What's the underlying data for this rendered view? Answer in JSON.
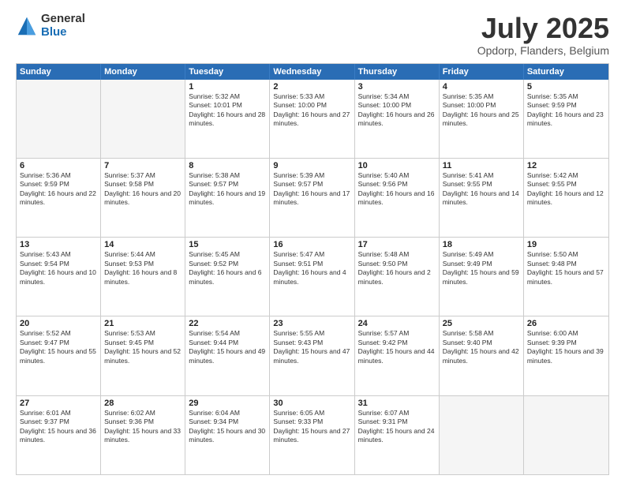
{
  "logo": {
    "general": "General",
    "blue": "Blue"
  },
  "title": "July 2025",
  "location": "Opdorp, Flanders, Belgium",
  "days": [
    "Sunday",
    "Monday",
    "Tuesday",
    "Wednesday",
    "Thursday",
    "Friday",
    "Saturday"
  ],
  "weeks": [
    [
      {
        "day": "",
        "empty": true
      },
      {
        "day": "",
        "empty": true
      },
      {
        "day": "1",
        "sunrise": "Sunrise: 5:32 AM",
        "sunset": "Sunset: 10:01 PM",
        "daylight": "Daylight: 16 hours and 28 minutes."
      },
      {
        "day": "2",
        "sunrise": "Sunrise: 5:33 AM",
        "sunset": "Sunset: 10:00 PM",
        "daylight": "Daylight: 16 hours and 27 minutes."
      },
      {
        "day": "3",
        "sunrise": "Sunrise: 5:34 AM",
        "sunset": "Sunset: 10:00 PM",
        "daylight": "Daylight: 16 hours and 26 minutes."
      },
      {
        "day": "4",
        "sunrise": "Sunrise: 5:35 AM",
        "sunset": "Sunset: 10:00 PM",
        "daylight": "Daylight: 16 hours and 25 minutes."
      },
      {
        "day": "5",
        "sunrise": "Sunrise: 5:35 AM",
        "sunset": "Sunset: 9:59 PM",
        "daylight": "Daylight: 16 hours and 23 minutes."
      }
    ],
    [
      {
        "day": "6",
        "sunrise": "Sunrise: 5:36 AM",
        "sunset": "Sunset: 9:59 PM",
        "daylight": "Daylight: 16 hours and 22 minutes."
      },
      {
        "day": "7",
        "sunrise": "Sunrise: 5:37 AM",
        "sunset": "Sunset: 9:58 PM",
        "daylight": "Daylight: 16 hours and 20 minutes."
      },
      {
        "day": "8",
        "sunrise": "Sunrise: 5:38 AM",
        "sunset": "Sunset: 9:57 PM",
        "daylight": "Daylight: 16 hours and 19 minutes."
      },
      {
        "day": "9",
        "sunrise": "Sunrise: 5:39 AM",
        "sunset": "Sunset: 9:57 PM",
        "daylight": "Daylight: 16 hours and 17 minutes."
      },
      {
        "day": "10",
        "sunrise": "Sunrise: 5:40 AM",
        "sunset": "Sunset: 9:56 PM",
        "daylight": "Daylight: 16 hours and 16 minutes."
      },
      {
        "day": "11",
        "sunrise": "Sunrise: 5:41 AM",
        "sunset": "Sunset: 9:55 PM",
        "daylight": "Daylight: 16 hours and 14 minutes."
      },
      {
        "day": "12",
        "sunrise": "Sunrise: 5:42 AM",
        "sunset": "Sunset: 9:55 PM",
        "daylight": "Daylight: 16 hours and 12 minutes."
      }
    ],
    [
      {
        "day": "13",
        "sunrise": "Sunrise: 5:43 AM",
        "sunset": "Sunset: 9:54 PM",
        "daylight": "Daylight: 16 hours and 10 minutes."
      },
      {
        "day": "14",
        "sunrise": "Sunrise: 5:44 AM",
        "sunset": "Sunset: 9:53 PM",
        "daylight": "Daylight: 16 hours and 8 minutes."
      },
      {
        "day": "15",
        "sunrise": "Sunrise: 5:45 AM",
        "sunset": "Sunset: 9:52 PM",
        "daylight": "Daylight: 16 hours and 6 minutes."
      },
      {
        "day": "16",
        "sunrise": "Sunrise: 5:47 AM",
        "sunset": "Sunset: 9:51 PM",
        "daylight": "Daylight: 16 hours and 4 minutes."
      },
      {
        "day": "17",
        "sunrise": "Sunrise: 5:48 AM",
        "sunset": "Sunset: 9:50 PM",
        "daylight": "Daylight: 16 hours and 2 minutes."
      },
      {
        "day": "18",
        "sunrise": "Sunrise: 5:49 AM",
        "sunset": "Sunset: 9:49 PM",
        "daylight": "Daylight: 15 hours and 59 minutes."
      },
      {
        "day": "19",
        "sunrise": "Sunrise: 5:50 AM",
        "sunset": "Sunset: 9:48 PM",
        "daylight": "Daylight: 15 hours and 57 minutes."
      }
    ],
    [
      {
        "day": "20",
        "sunrise": "Sunrise: 5:52 AM",
        "sunset": "Sunset: 9:47 PM",
        "daylight": "Daylight: 15 hours and 55 minutes."
      },
      {
        "day": "21",
        "sunrise": "Sunrise: 5:53 AM",
        "sunset": "Sunset: 9:45 PM",
        "daylight": "Daylight: 15 hours and 52 minutes."
      },
      {
        "day": "22",
        "sunrise": "Sunrise: 5:54 AM",
        "sunset": "Sunset: 9:44 PM",
        "daylight": "Daylight: 15 hours and 49 minutes."
      },
      {
        "day": "23",
        "sunrise": "Sunrise: 5:55 AM",
        "sunset": "Sunset: 9:43 PM",
        "daylight": "Daylight: 15 hours and 47 minutes."
      },
      {
        "day": "24",
        "sunrise": "Sunrise: 5:57 AM",
        "sunset": "Sunset: 9:42 PM",
        "daylight": "Daylight: 15 hours and 44 minutes."
      },
      {
        "day": "25",
        "sunrise": "Sunrise: 5:58 AM",
        "sunset": "Sunset: 9:40 PM",
        "daylight": "Daylight: 15 hours and 42 minutes."
      },
      {
        "day": "26",
        "sunrise": "Sunrise: 6:00 AM",
        "sunset": "Sunset: 9:39 PM",
        "daylight": "Daylight: 15 hours and 39 minutes."
      }
    ],
    [
      {
        "day": "27",
        "sunrise": "Sunrise: 6:01 AM",
        "sunset": "Sunset: 9:37 PM",
        "daylight": "Daylight: 15 hours and 36 minutes."
      },
      {
        "day": "28",
        "sunrise": "Sunrise: 6:02 AM",
        "sunset": "Sunset: 9:36 PM",
        "daylight": "Daylight: 15 hours and 33 minutes."
      },
      {
        "day": "29",
        "sunrise": "Sunrise: 6:04 AM",
        "sunset": "Sunset: 9:34 PM",
        "daylight": "Daylight: 15 hours and 30 minutes."
      },
      {
        "day": "30",
        "sunrise": "Sunrise: 6:05 AM",
        "sunset": "Sunset: 9:33 PM",
        "daylight": "Daylight: 15 hours and 27 minutes."
      },
      {
        "day": "31",
        "sunrise": "Sunrise: 6:07 AM",
        "sunset": "Sunset: 9:31 PM",
        "daylight": "Daylight: 15 hours and 24 minutes."
      },
      {
        "day": "",
        "empty": true
      },
      {
        "day": "",
        "empty": true
      }
    ]
  ]
}
